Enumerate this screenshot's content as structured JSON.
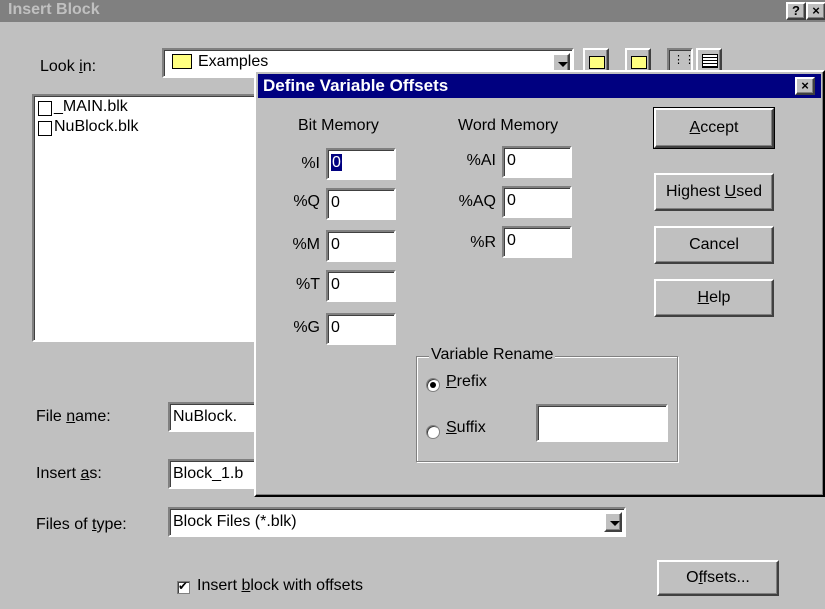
{
  "insert_block": {
    "title": "Insert Block",
    "help_btn": "?",
    "close_btn": "×",
    "look_in_label": "Look in:",
    "look_in_value": "Examples",
    "files": [
      "_MAIN.blk",
      "NuBlock.blk"
    ],
    "file_name_label": "File name:",
    "file_name_value": "NuBlock.",
    "insert_as_label": "Insert as:",
    "insert_as_value": "Block_1.b",
    "files_of_type_label": "Files of type:",
    "files_of_type_value": "Block Files (*.blk)",
    "insert_with_offsets_label": "Insert block with offsets",
    "insert_with_offsets_checked": true,
    "offsets_button": "Offsets..."
  },
  "define_offsets": {
    "title": "Define Variable Offsets",
    "close_btn": "×",
    "bit_memory_heading": "Bit Memory",
    "word_memory_heading": "Word Memory",
    "bit_fields": [
      {
        "label": "%I",
        "value": "0"
      },
      {
        "label": "%Q",
        "value": "0"
      },
      {
        "label": "%M",
        "value": "0"
      },
      {
        "label": "%T",
        "value": "0"
      },
      {
        "label": "%G",
        "value": "0"
      }
    ],
    "word_fields": [
      {
        "label": "%AI",
        "value": "0"
      },
      {
        "label": "%AQ",
        "value": "0"
      },
      {
        "label": "%R",
        "value": "0"
      }
    ],
    "buttons": {
      "accept": "Accept",
      "highest_used": "Highest Used",
      "cancel": "Cancel",
      "help": "Help"
    },
    "rename_group": {
      "title": "Variable Rename",
      "prefix": "Prefix",
      "suffix": "Suffix",
      "selected": "prefix",
      "suffix_value": ""
    }
  }
}
